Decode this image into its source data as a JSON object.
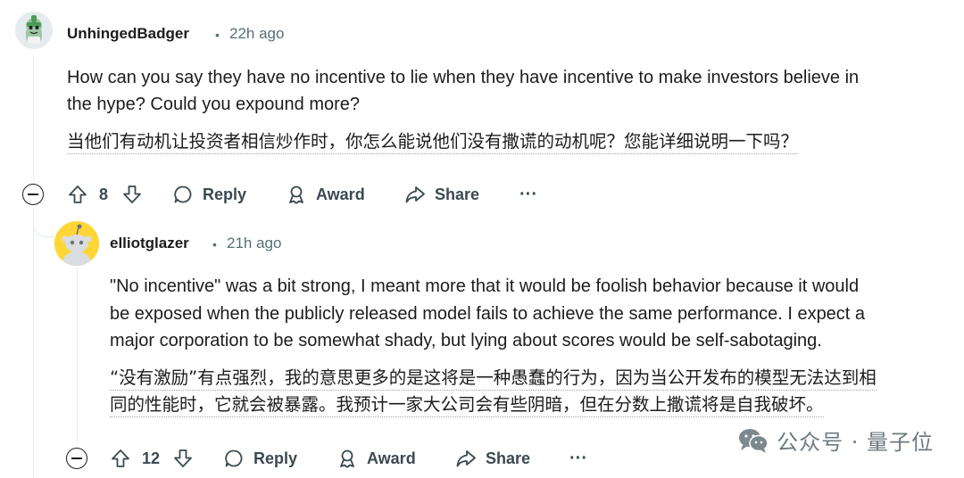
{
  "comment1": {
    "username": "UnhingedBadger",
    "separator": "•",
    "time": "22h ago",
    "body_line1": "How can you say they have no incentive to lie when they have incentive to make investors believe in",
    "body_line2": "the hype? Could you expound more?",
    "translation": "当他们有动机让投资者相信炒作时，你怎么能说他们没有撒谎的动机呢？您能详细说明一下吗？",
    "votes": "8",
    "reply_label": "Reply",
    "award_label": "Award",
    "share_label": "Share",
    "more_label": "···"
  },
  "comment2": {
    "username": "elliotglazer",
    "separator": "•",
    "time": "21h ago",
    "body_line1": "\"No incentive\" was a bit strong, I meant more that it would be foolish behavior because it would",
    "body_line2": "be exposed when the publicly released model fails to achieve the same performance. I expect a",
    "body_line3": "major corporation to be somewhat shady, but lying about scores would be self-sabotaging.",
    "translation_line1": "“没有激励”有点强烈，我的意思更多的是这将是一种愚蠢的行为，因为当公开发布的模型无法达到相",
    "translation_line2": "同的性能时，它就会被暴露。我预计一家大公司会有些阴暗，但在分数上撒谎将是自我破坏。",
    "votes": "12",
    "reply_label": "Reply",
    "award_label": "Award",
    "share_label": "Share",
    "more_label": "···"
  },
  "watermark": {
    "text": "公众号 · 量子位"
  },
  "colors": {
    "text": "#1c1c1c",
    "meta": "#576f76",
    "avatar1_bg": "#e5ebee",
    "avatar2_bg": "#ffd635"
  }
}
